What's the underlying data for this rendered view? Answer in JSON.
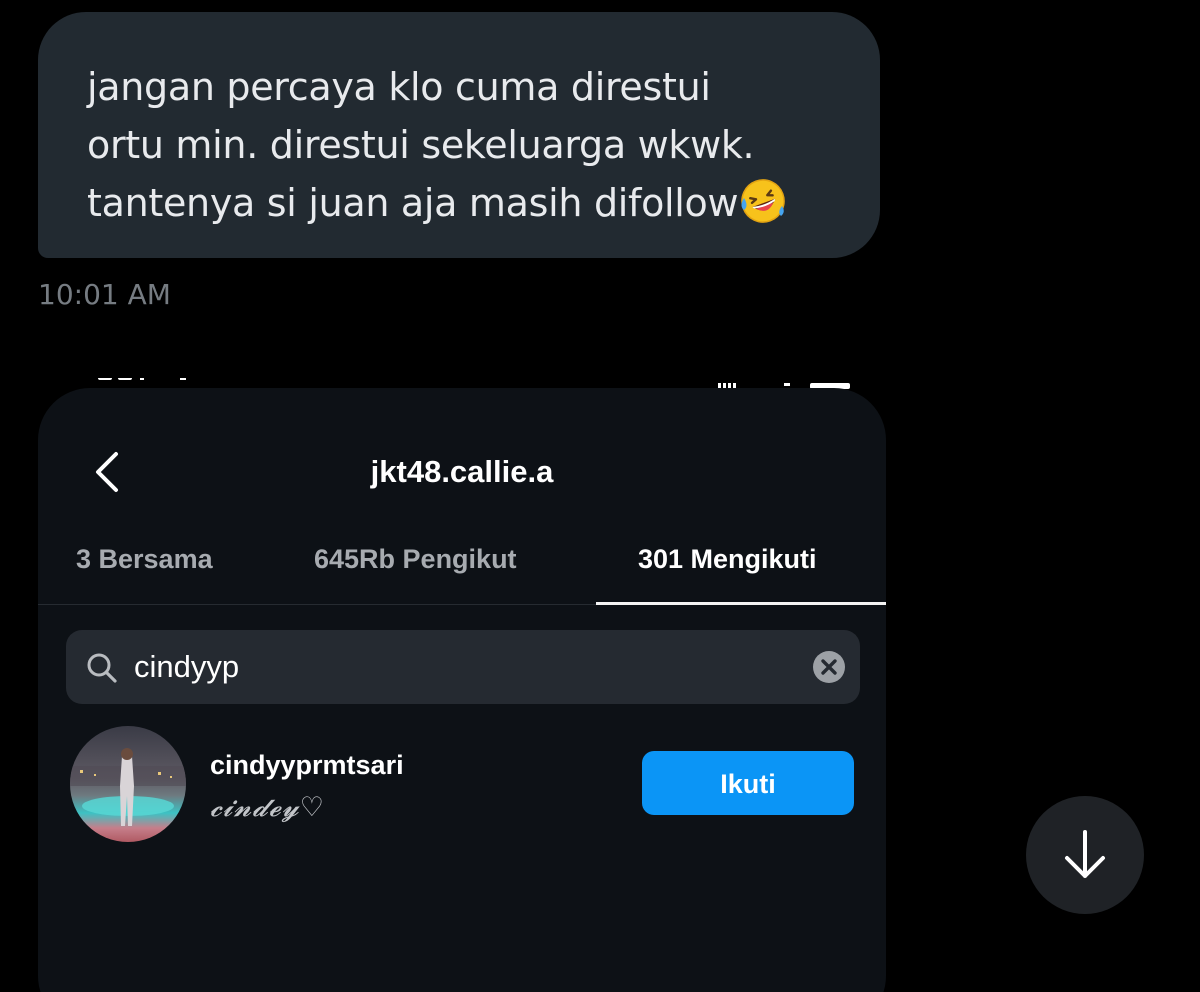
{
  "message": {
    "lines": [
      "jangan percaya klo cuma direstui",
      "ortu min. direstui sekeluarga wkwk.",
      "tantenya si juan aja masih difollow"
    ],
    "emoji": "rolling-on-the-floor-laughing",
    "timestamp": "10:01 AM",
    "bubble_color": "#222a31"
  },
  "screenshot": {
    "header": {
      "title": "jkt48.callie.a",
      "back_icon": "chevron-left-icon"
    },
    "tabs": [
      {
        "label": "3 Bersama",
        "active": false
      },
      {
        "label": "645Rb Pengikut",
        "active": false
      },
      {
        "label": "301 Mengikuti",
        "active": true
      }
    ],
    "search": {
      "value": "cindyyp",
      "icon": "search-icon",
      "clear_icon": "clear-icon"
    },
    "result": {
      "username": "cindyyprmtsari",
      "display_name": "𝓬𝓲𝓷𝓭𝓮𝔂♡",
      "follow_label": "Ikuti",
      "follow_color": "#0b95f6"
    }
  },
  "scroll_button": {
    "icon": "arrow-down-icon"
  }
}
